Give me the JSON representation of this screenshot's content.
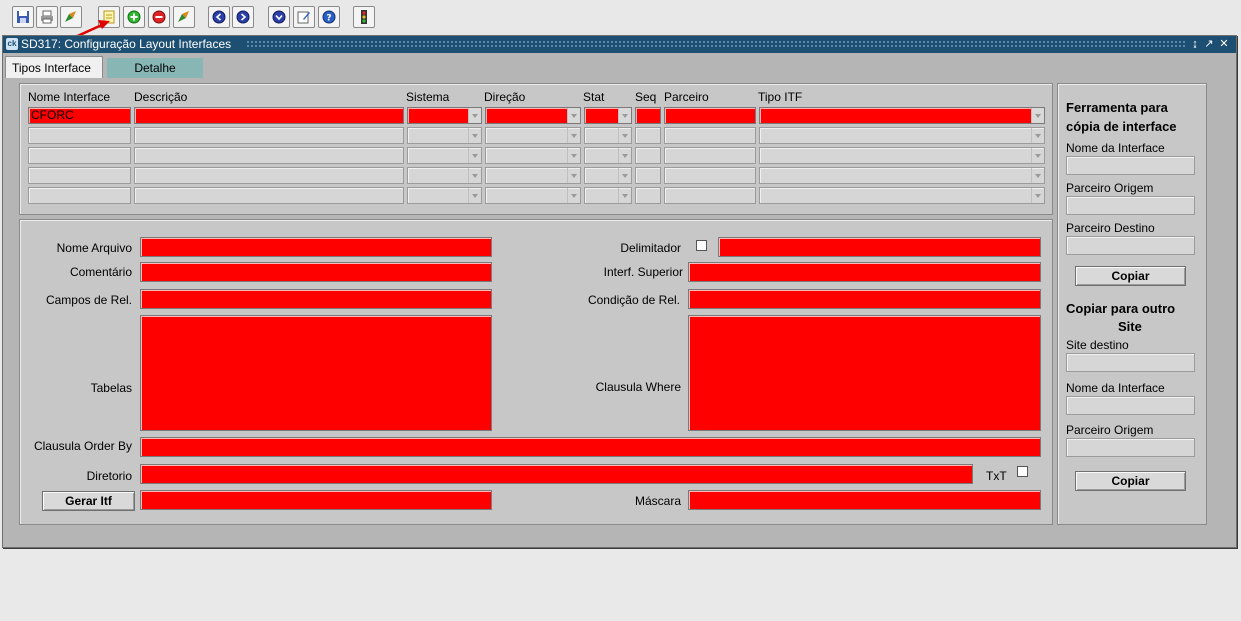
{
  "toolbar": {
    "icons": [
      "save-icon",
      "print-icon",
      "edit-icon",
      "new-record-icon",
      "add-icon",
      "remove-icon",
      "export-icon",
      "first-icon",
      "next-icon",
      "down-icon",
      "note-icon",
      "help-icon",
      "exit-icon"
    ]
  },
  "window": {
    "title": "SD317: Configuração Layout Interfaces",
    "icon_text": "ck"
  },
  "tabs": [
    {
      "label": "Tipos Interface"
    },
    {
      "label": "Detalhe"
    }
  ],
  "grid": {
    "columns": [
      "Nome Interface",
      "Descrição",
      "Sistema",
      "Direção",
      "Stat",
      "Seq",
      "Parceiro",
      "Tipo ITF"
    ],
    "first_row_value": "CFORC"
  },
  "detail": {
    "nome_arquivo_label": "Nome Arquivo",
    "comentario_label": "Comentário",
    "campos_rel_label": "Campos de Rel.",
    "tabelas_label": "Tabelas",
    "order_by_label": "Clausula Order By",
    "diretorio_label": "Diretorio",
    "gerar_itf_button": "Gerar Itf",
    "delimitador_label": "Delimitador",
    "interf_superior_label": "Interf. Superior",
    "condicao_rel_label": "Condição de Rel.",
    "where_label": "Clausula Where",
    "txt_label": "TxT",
    "mascara_label": "Máscara"
  },
  "side": {
    "copy_tool_title_1": "Ferramenta para",
    "copy_tool_title_2": "cópia de interface",
    "nome_interface_label": "Nome da Interface",
    "parceiro_origem_label": "Parceiro Origem",
    "parceiro_destino_label": "Parceiro Destino",
    "copiar_button": "Copiar",
    "copy_site_title_1": "Copiar para outro",
    "copy_site_title_2": "Site",
    "site_destino_label": "Site destino",
    "nome_interface_label_2": "Nome da Interface",
    "parceiro_origem_label_2": "Parceiro Origem",
    "copiar_button_2": "Copiar"
  },
  "colors": {
    "required_field": "#ff0000",
    "title_bar": "#1d4f72",
    "inactive_tab": "#87b6b5"
  }
}
